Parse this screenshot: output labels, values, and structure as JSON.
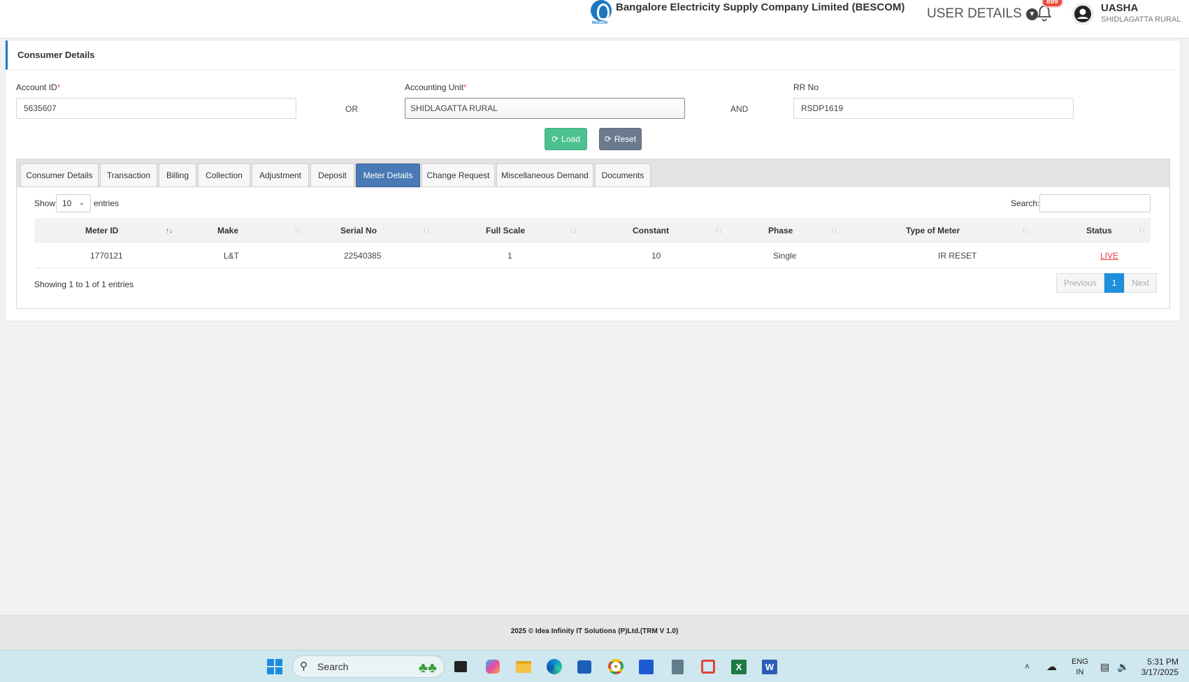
{
  "header": {
    "brand_name": "Bangalore Electricity Supply Company Limited (BESCOM)",
    "brand_tag": "BESCOM",
    "user_details_label": "USER DETAILS",
    "notification_count": "899",
    "user_name": "UASHA",
    "user_location": "SHIDLAGATTA RURAL"
  },
  "card": {
    "title": "Consumer Details",
    "account_id_label": "Account ID",
    "account_id_value": "5635607",
    "or_label": "OR",
    "accounting_unit_label": "Accounting Unit",
    "accounting_unit_value": "SHIDLAGATTA RURAL",
    "and_label": "AND",
    "rr_no_label": "RR No",
    "rr_no_value": "RSDP1619",
    "load_label": "Load",
    "reset_label": "Reset"
  },
  "tabs": [
    "Consumer Details",
    "Transaction",
    "Billing",
    "Collection",
    "Adjustment",
    "Deposit",
    "Meter Details",
    "Change Request",
    "Miscellaneous Demand",
    "Documents"
  ],
  "active_tab": "Meter Details",
  "table": {
    "show_label": "Show",
    "entries_value": "10",
    "entries_label": "entries",
    "search_label": "Search:",
    "columns": [
      "Meter ID",
      "Make",
      "Serial No",
      "Full Scale",
      "Constant",
      "Phase",
      "Type of Meter",
      "Status"
    ],
    "rows": [
      [
        "1770121",
        "L&T",
        "22540385",
        "1",
        "10",
        "Single",
        "IR RESET",
        "LIVE"
      ]
    ],
    "info": "Showing 1 to 1 of 1 entries",
    "prev_label": "Previous",
    "page": "1",
    "next_label": "Next"
  },
  "footer": {
    "text": "2025 © Idea Infinity IT Solutions (P)Ltd.(TRM V 1.0)"
  },
  "taskbar": {
    "search_placeholder": "Search",
    "lang_line1": "ENG",
    "lang_line2": "IN",
    "time": "5:31 PM",
    "date": "3/17/2025"
  },
  "colors": {
    "accent": "#1d78c1",
    "active_tab": "#4a7ab5",
    "load_button": "#4bc18f",
    "reset_button": "#6c7a8d",
    "status_live": "#e53935"
  }
}
